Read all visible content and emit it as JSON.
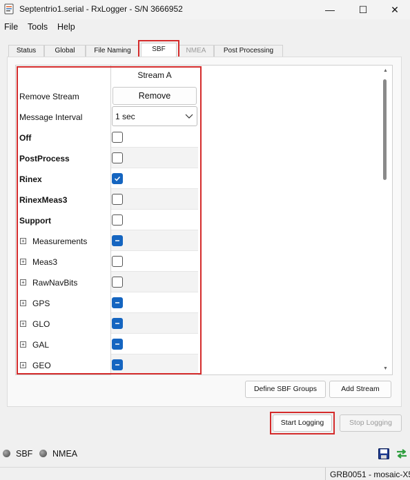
{
  "window": {
    "title": "Septentrio1.serial - RxLogger - S/N 3666952",
    "minimize_glyph": "—",
    "maximize_glyph": "☐",
    "close_glyph": "✕"
  },
  "menu": [
    "File",
    "Tools",
    "Help"
  ],
  "tabs": [
    {
      "label": "Status",
      "state": "normal"
    },
    {
      "label": "Global",
      "state": "normal"
    },
    {
      "label": "File Naming",
      "state": "normal"
    },
    {
      "label": "SBF",
      "state": "active"
    },
    {
      "label": "NMEA",
      "state": "disabled"
    },
    {
      "label": "Post Processing",
      "state": "normal"
    }
  ],
  "grid": {
    "column_header": "Stream A",
    "remove_row_label": "Remove Stream",
    "remove_button": "Remove",
    "interval_row_label": "Message Interval",
    "interval_value": "1 sec",
    "rows": [
      {
        "label": "Off",
        "bold": true,
        "expandable": false,
        "state": "unchecked"
      },
      {
        "label": "PostProcess",
        "bold": true,
        "expandable": false,
        "state": "unchecked"
      },
      {
        "label": "Rinex",
        "bold": true,
        "expandable": false,
        "state": "checked"
      },
      {
        "label": "RinexMeas3",
        "bold": true,
        "expandable": false,
        "state": "unchecked"
      },
      {
        "label": "Support",
        "bold": true,
        "expandable": false,
        "state": "unchecked"
      },
      {
        "label": "Measurements",
        "bold": false,
        "expandable": true,
        "state": "partial"
      },
      {
        "label": "Meas3",
        "bold": false,
        "expandable": true,
        "state": "unchecked"
      },
      {
        "label": "RawNavBits",
        "bold": false,
        "expandable": true,
        "state": "unchecked"
      },
      {
        "label": "GPS",
        "bold": false,
        "expandable": true,
        "state": "partial"
      },
      {
        "label": "GLO",
        "bold": false,
        "expandable": true,
        "state": "partial"
      },
      {
        "label": "GAL",
        "bold": false,
        "expandable": true,
        "state": "partial"
      },
      {
        "label": "GEO",
        "bold": false,
        "expandable": true,
        "state": "partial"
      }
    ]
  },
  "buttons": {
    "define_groups": "Define SBF Groups",
    "add_stream": "Add Stream",
    "start_logging": "Start Logging",
    "stop_logging": "Stop Logging"
  },
  "status": {
    "sbf_label": "SBF",
    "nmea_label": "NMEA"
  },
  "footer": {
    "device": "GRB0051 - mosaic-X5"
  },
  "colors": {
    "highlight": "#d42a2a",
    "checkbox_accent": "#1565c0",
    "swap_icon": "#2e9e3e"
  }
}
